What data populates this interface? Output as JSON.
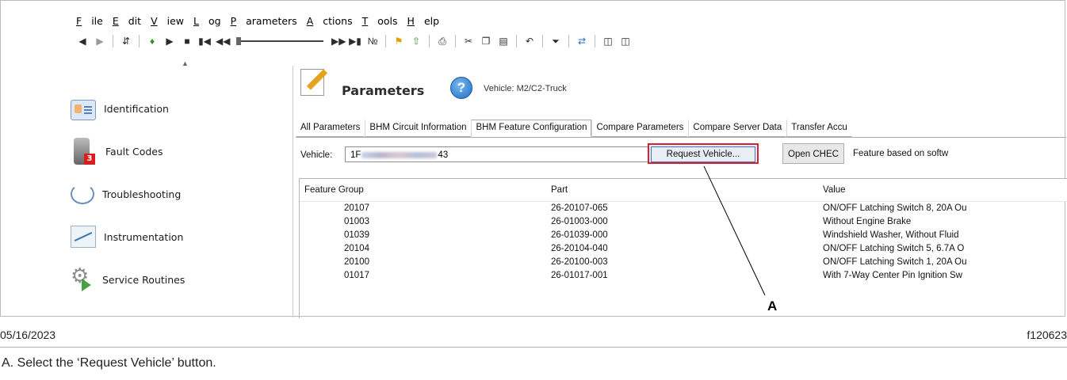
{
  "menu": [
    {
      "label": "File",
      "ul": "F",
      "rest": "ile"
    },
    {
      "label": "Edit",
      "ul": "E",
      "rest": "dit"
    },
    {
      "label": "View",
      "ul": "V",
      "rest": "iew"
    },
    {
      "label": "Log",
      "ul": "L",
      "rest": "og"
    },
    {
      "label": "Parameters",
      "ul": "P",
      "rest": "arameters"
    },
    {
      "label": "Actions",
      "ul": "A",
      "rest": "ctions"
    },
    {
      "label": "Tools",
      "ul": "T",
      "rest": "ools"
    },
    {
      "label": "Help",
      "ul": "H",
      "rest": "elp"
    }
  ],
  "toolbar_icons": [
    "back-arrow-icon",
    "forward-arrow-icon",
    "transfer-icon",
    "connect-icon",
    "play-icon",
    "stop-icon",
    "skip-back-icon",
    "rewind-icon",
    "fast-forward-icon",
    "skip-forward-icon",
    "marker-icon",
    "flag-icon",
    "export-icon",
    "print-icon",
    "cut-icon",
    "copy-icon",
    "paste-icon",
    "undo-icon",
    "filter-icon",
    "sync-icon",
    "window-tile-icon",
    "window-cascade-icon"
  ],
  "sidebar": {
    "items": [
      {
        "label": "Identification",
        "icon": "id-card-icon"
      },
      {
        "label": "Fault Codes",
        "icon": "fault-codes-icon",
        "badge": "3"
      },
      {
        "label": "Troubleshooting",
        "icon": "stethoscope-icon"
      },
      {
        "label": "Instrumentation",
        "icon": "instrument-graph-icon"
      },
      {
        "label": "Service Routines",
        "icon": "service-gears-icon"
      }
    ]
  },
  "header": {
    "title": "Parameters",
    "help_glyph": "?",
    "vehicle_label": "Vehicle: M2/C2-Truck"
  },
  "tabs": [
    {
      "label": "All Parameters",
      "selected": false
    },
    {
      "label": "BHM Circuit Information",
      "selected": false
    },
    {
      "label": "BHM Feature Configuration",
      "selected": true
    },
    {
      "label": "Compare Parameters",
      "selected": false
    },
    {
      "label": "Compare Server Data",
      "selected": false
    },
    {
      "label": "Transfer Accu",
      "selected": false
    }
  ],
  "vehicle_row": {
    "label": "Vehicle:",
    "vin_prefix": "1F",
    "vin_suffix": "43",
    "request_button": "Request Vehicle...",
    "chec_button": "Open CHEC",
    "feature_note": "Feature based on softw"
  },
  "grid": {
    "columns": [
      "Feature Group",
      "Part",
      "Value"
    ],
    "rows": [
      [
        "20107",
        "26-20107-065",
        "ON/OFF Latching Switch 8, 20A Ou"
      ],
      [
        "01003",
        "26-01003-000",
        "Without Engine Brake"
      ],
      [
        "01039",
        "26-01039-000",
        "Windshield Washer, Without Fluid"
      ],
      [
        "20104",
        "26-20104-040",
        "ON/OFF Latching Switch 5, 6.7A O"
      ],
      [
        "20100",
        "26-20100-003",
        "ON/OFF Latching Switch 1, 20A Ou"
      ],
      [
        "01017",
        "26-01017-001",
        "With 7-Way Center Pin Ignition Sw"
      ]
    ]
  },
  "callout": {
    "letter": "A"
  },
  "footer": {
    "date": "05/16/2023",
    "figure_id": "f120623",
    "caption": "A.  Select the ‘Request Vehicle’ button."
  },
  "colors": {
    "highlight_border": "#d8212b",
    "focus_border": "#3b77c5",
    "badge": "#d91c1c"
  }
}
